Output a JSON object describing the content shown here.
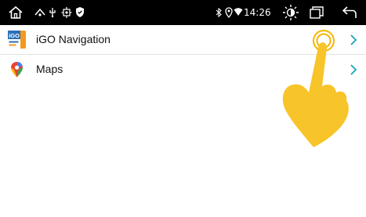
{
  "status_bar": {
    "time": "14:26",
    "icons": [
      "home-icon",
      "usb-icon",
      "usb-connection-icon",
      "settings-icon",
      "shield-icon",
      "bluetooth-icon",
      "location-icon",
      "wifi-icon",
      "brightness-icon",
      "recent-apps-icon",
      "back-icon"
    ]
  },
  "apps": [
    {
      "label": "iGO Navigation",
      "icon": "igo-primo-icon"
    },
    {
      "label": "Maps",
      "icon": "maps-pin-icon"
    }
  ],
  "colors": {
    "status_bar_bg": "#000000",
    "chevron": "#1aa3b8",
    "hand": "#f7c42a",
    "tap_ring": "#f7b500"
  }
}
